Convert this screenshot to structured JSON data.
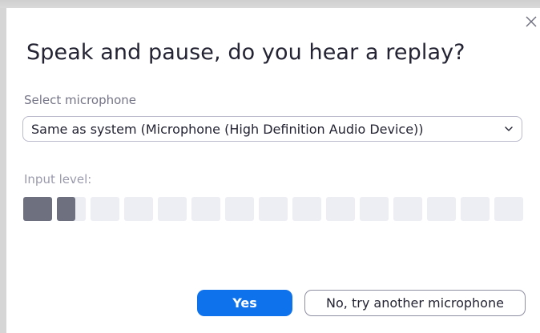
{
  "dialog": {
    "title": "Speak and pause, do you hear a replay?",
    "close_icon": "close-icon"
  },
  "microphone": {
    "label": "Select microphone",
    "selected_value": "Same as system (Microphone (High Definition Audio Device))",
    "chevron_icon": "chevron-down-icon"
  },
  "input_level": {
    "label": "Input level:",
    "segment_count": 15,
    "level": 0.11,
    "active_color": "#6e7080",
    "inactive_color": "#ededf4"
  },
  "buttons": {
    "yes_label": "Yes",
    "no_label": "No, try another microphone"
  },
  "colors": {
    "accent": "#0e72ed",
    "title_text": "#232333",
    "muted_text": "#747487"
  }
}
